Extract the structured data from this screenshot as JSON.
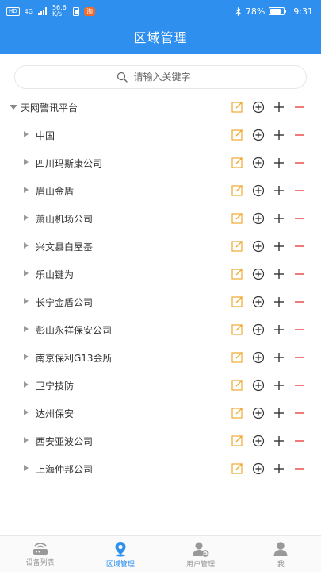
{
  "status": {
    "network": "HD",
    "signal": "4G",
    "speed": "56.6 K/s",
    "badge": "淘",
    "battery": "78%",
    "battery_level": 0.78,
    "time": "9:31"
  },
  "header": {
    "title": "区域管理"
  },
  "search": {
    "placeholder": "请输入关键字"
  },
  "tree": {
    "root": "天网警讯平台",
    "children": [
      "中国",
      "四川玛斯康公司",
      "眉山金盾",
      "萧山机场公司",
      "兴文县白屋基",
      "乐山键为",
      "长宁金盾公司",
      "彭山永祥保安公司",
      "南京保利G13会所",
      "卫宁技防",
      "达州保安",
      "西安亚波公司",
      "上海仲邦公司"
    ]
  },
  "colors": {
    "primary": "#2e8fef",
    "edit": "#f0a830",
    "delete": "#e84040",
    "icon": "#333333"
  },
  "nav": [
    {
      "label": "设备列表",
      "icon": "router-icon",
      "active": false
    },
    {
      "label": "区域管理",
      "icon": "location-pin-icon",
      "active": true
    },
    {
      "label": "用户管理",
      "icon": "user-settings-icon",
      "active": false
    },
    {
      "label": "我",
      "icon": "person-icon",
      "active": false
    }
  ]
}
